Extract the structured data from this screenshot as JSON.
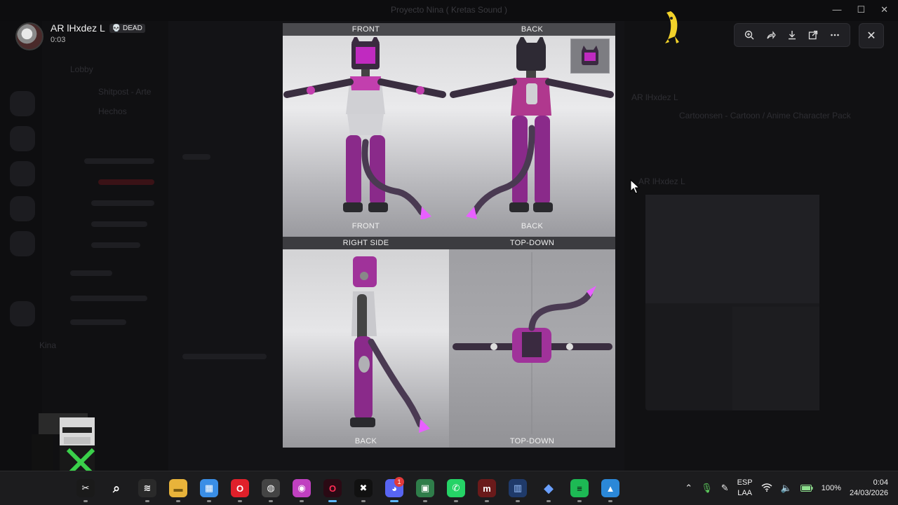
{
  "window": {
    "title": "Proyecto Nina ( Kretas Sound )"
  },
  "voice_user": {
    "name": "AR lHxdez L",
    "badge": "💀 DEAD",
    "elapsed": "0:03"
  },
  "background": {
    "sidebar_items": [
      "Lobby",
      "Shitpost - Arte",
      "Hechos",
      "Kina"
    ],
    "chat_name_1": "AR lHxdez L",
    "chat_name_2": "AR lHxdez L",
    "dead_tag": "DEAD",
    "embed_title": "Cartoonsen - Cartoon / Anime Character Pack"
  },
  "image": {
    "panels": {
      "front": {
        "header": "FRONT",
        "footer": "FRONT"
      },
      "back": {
        "header": "BACK",
        "footer": "BACK"
      },
      "right_side": {
        "header": "RIGHT SIDE",
        "footer": "BACK"
      },
      "top_down": {
        "header": "TOP-DOWN",
        "footer": "TOP-DOWN"
      }
    }
  },
  "toolbar": {
    "zoom": "zoom-in-icon",
    "forward": "share-arrow-icon",
    "download": "download-icon",
    "open": "open-external-icon",
    "more": "more-icon",
    "close": "close-icon"
  },
  "taskbar": {
    "apps": [
      {
        "name": "capcut",
        "glyph": "✂",
        "color": "#1a1a1a",
        "fg": "#fff"
      },
      {
        "name": "search",
        "glyph": "⌕",
        "color": "transparent",
        "fg": "#fff"
      },
      {
        "name": "capcut-alt",
        "glyph": "≋",
        "color": "#2a2a2a",
        "fg": "#fff"
      },
      {
        "name": "file-explorer",
        "glyph": "▬",
        "color": "#e8b33a",
        "fg": "#7a5a10"
      },
      {
        "name": "microsoft-store",
        "glyph": "▦",
        "color": "#3a8ee6",
        "fg": "#fff"
      },
      {
        "name": "opera",
        "glyph": "O",
        "color": "#e0202a",
        "fg": "#fff"
      },
      {
        "name": "chromium-tool",
        "glyph": "◍",
        "color": "#444",
        "fg": "#fff"
      },
      {
        "name": "paint-app",
        "glyph": "◉",
        "color": "#c040c0",
        "fg": "#fff"
      },
      {
        "name": "opera-gx",
        "glyph": "O",
        "color": "#2a0a14",
        "fg": "#ff2d55"
      },
      {
        "name": "capcut-2",
        "glyph": "✖",
        "color": "#111",
        "fg": "#fff"
      },
      {
        "name": "discord",
        "glyph": "◕",
        "color": "#5865f2",
        "fg": "#fff",
        "badge": "1"
      },
      {
        "name": "screen-tool",
        "glyph": "▣",
        "color": "#2f7d4a",
        "fg": "#fff"
      },
      {
        "name": "whatsapp",
        "glyph": "✆",
        "color": "#25d366",
        "fg": "#fff"
      },
      {
        "name": "mega",
        "glyph": "m",
        "color": "#6a1a1a",
        "fg": "#fff"
      },
      {
        "name": "audio-tool",
        "glyph": "▥",
        "color": "#1f3a6a",
        "fg": "#9cc4ff"
      },
      {
        "name": "diamond-app",
        "glyph": "◆",
        "color": "transparent",
        "fg": "#6aa0ff"
      },
      {
        "name": "spotify",
        "glyph": "≡",
        "color": "#1db954",
        "fg": "#0b0b0b"
      },
      {
        "name": "photos",
        "glyph": "▲",
        "color": "#2b88d8",
        "fg": "#fff"
      }
    ],
    "tray": {
      "lang_top": "ESP",
      "lang_bottom": "LAA",
      "battery": "100%",
      "time": "0:04",
      "date": "24/03/2026"
    }
  }
}
